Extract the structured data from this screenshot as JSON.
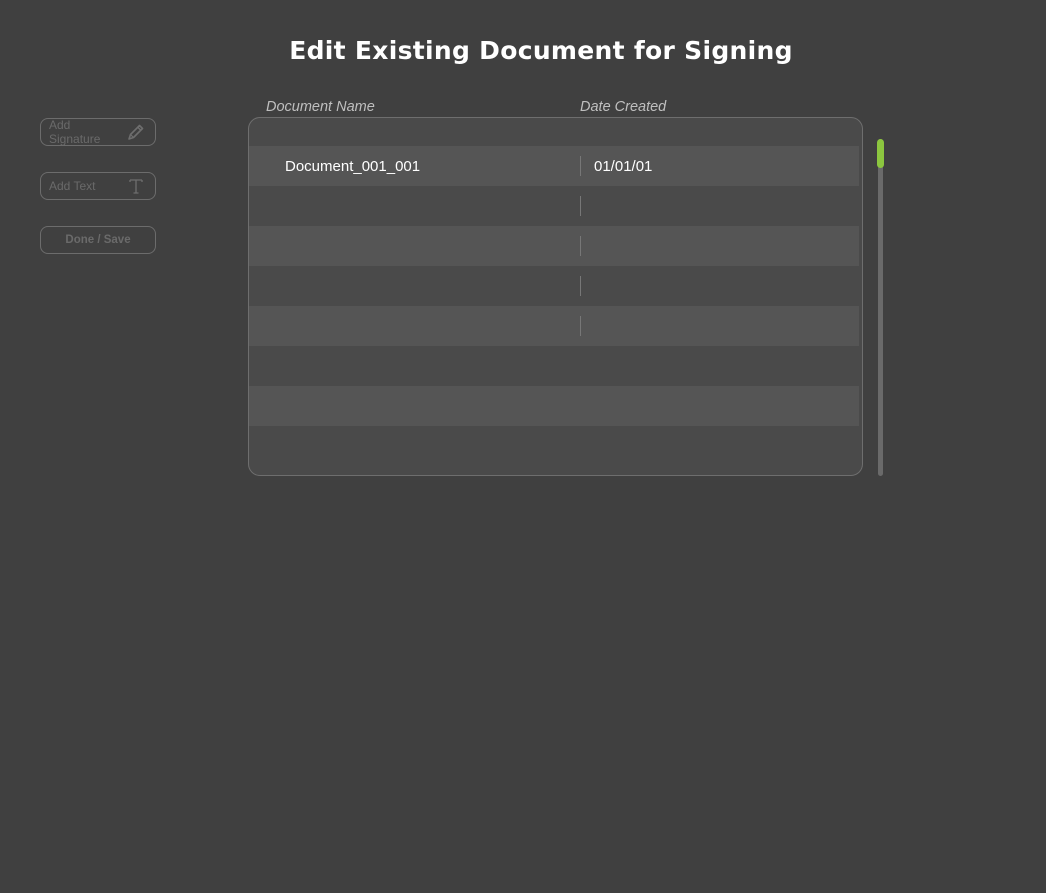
{
  "page": {
    "title": "Edit Existing Document for Signing"
  },
  "tools": {
    "add_signature": {
      "label": "Add Signature",
      "icon": "pencil-icon"
    },
    "add_text": {
      "label": "Add Text",
      "icon": "text-t-icon"
    },
    "done_save": {
      "label": "Done / Save"
    }
  },
  "table": {
    "columns": [
      "Document Name",
      "Date Created"
    ],
    "rows": [
      {
        "name": "",
        "date": ""
      },
      {
        "name": "Document_001_001",
        "date": "01/01/01"
      },
      {
        "name": "",
        "date": ""
      },
      {
        "name": "",
        "date": ""
      },
      {
        "name": "",
        "date": ""
      },
      {
        "name": "",
        "date": ""
      },
      {
        "name": "",
        "date": ""
      },
      {
        "name": "",
        "date": ""
      }
    ]
  },
  "colors": {
    "background": "#404040",
    "accent": "#8cc63f"
  }
}
